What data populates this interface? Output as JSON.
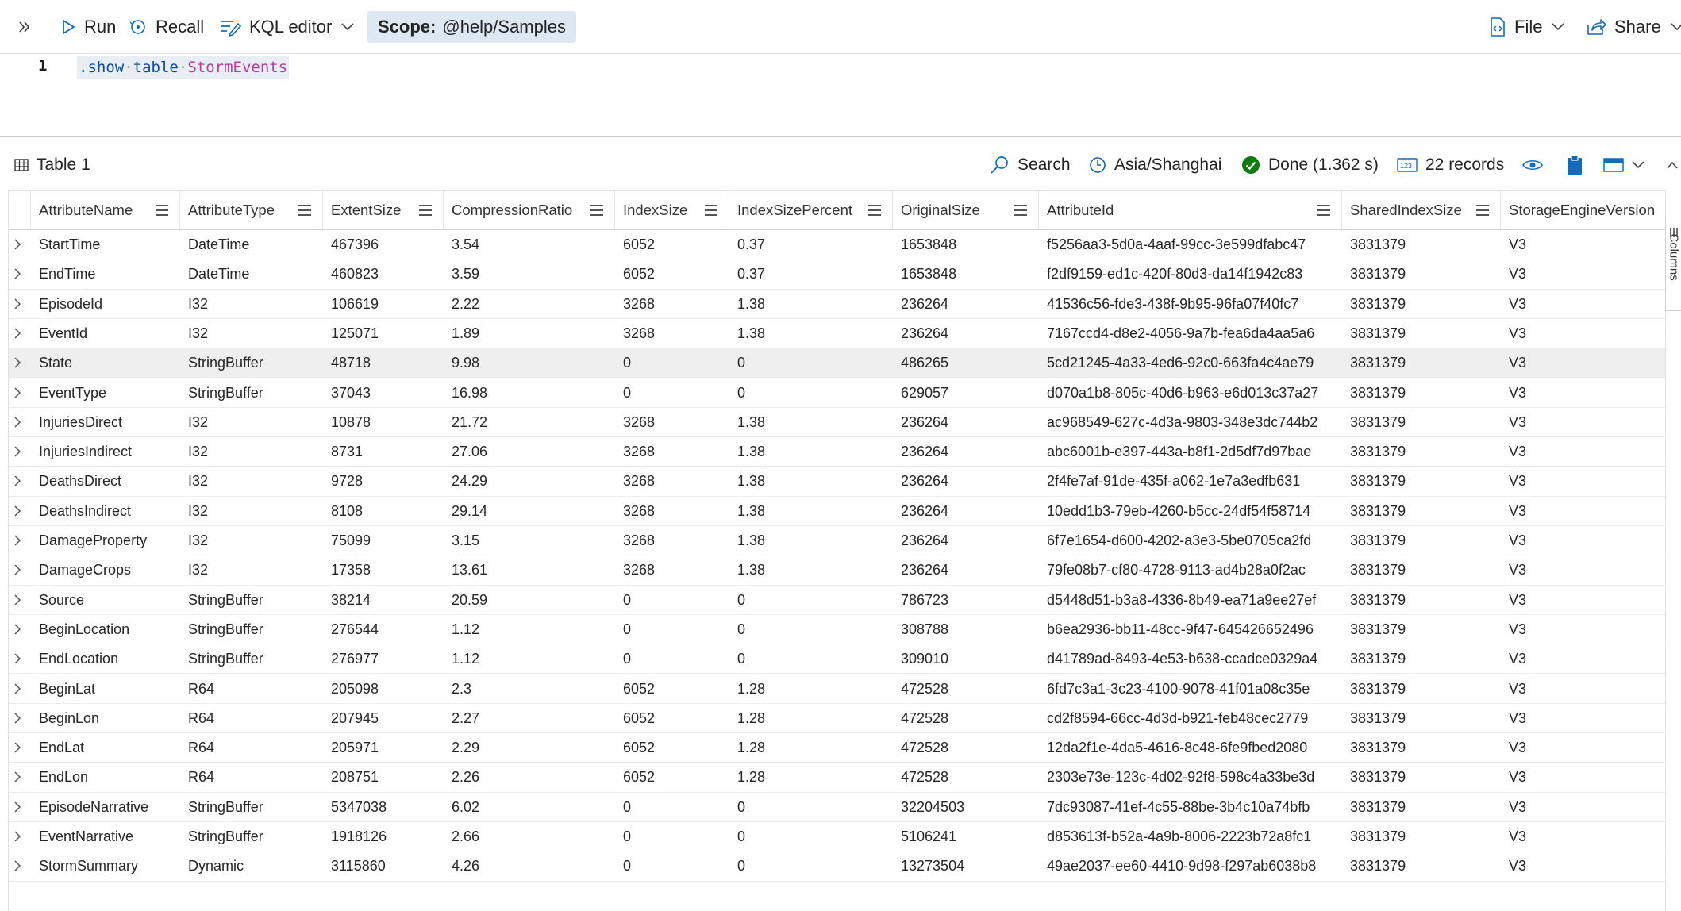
{
  "toolbar": {
    "run_label": "Run",
    "recall_label": "Recall",
    "editor_mode_label": "KQL editor",
    "scope_key": "Scope:",
    "scope_value": "@help/Samples",
    "file_label": "File",
    "share_label": "Share"
  },
  "editor": {
    "line_number": "1",
    "code": {
      "cmd": ".show",
      "kw": "table",
      "tbl": "StormEvents"
    }
  },
  "results": {
    "tab_label": "Table 1",
    "search_label": "Search",
    "timezone_label": "Asia/Shanghai",
    "status_label": "Done (1.362 s)",
    "records_label": "22 records",
    "columns_panel_label": "Columns",
    "status_color": "#107c10",
    "accent_color": "#0f6cbd"
  },
  "table": {
    "columns": [
      "AttributeName",
      "AttributeType",
      "ExtentSize",
      "CompressionRatio",
      "IndexSize",
      "IndexSizePercent",
      "OriginalSize",
      "AttributeId",
      "SharedIndexSize",
      "StorageEngineVersion"
    ],
    "rows": [
      [
        "StartTime",
        "DateTime",
        "467396",
        "3.54",
        "6052",
        "0.37",
        "1653848",
        "f5256aa3-5d0a-4aaf-99cc-3e599dfabc47",
        "3831379",
        "V3"
      ],
      [
        "EndTime",
        "DateTime",
        "460823",
        "3.59",
        "6052",
        "0.37",
        "1653848",
        "f2df9159-ed1c-420f-80d3-da14f1942c83",
        "3831379",
        "V3"
      ],
      [
        "EpisodeId",
        "I32",
        "106619",
        "2.22",
        "3268",
        "1.38",
        "236264",
        "41536c56-fde3-438f-9b95-96fa07f40fc7",
        "3831379",
        "V3"
      ],
      [
        "EventId",
        "I32",
        "125071",
        "1.89",
        "3268",
        "1.38",
        "236264",
        "7167ccd4-d8e2-4056-9a7b-fea6da4aa5a6",
        "3831379",
        "V3"
      ],
      [
        "State",
        "StringBuffer",
        "48718",
        "9.98",
        "0",
        "0",
        "486265",
        "5cd21245-4a33-4ed6-92c0-663fa4c4ae79",
        "3831379",
        "V3"
      ],
      [
        "EventType",
        "StringBuffer",
        "37043",
        "16.98",
        "0",
        "0",
        "629057",
        "d070a1b8-805c-40d6-b963-e6d013c37a27",
        "3831379",
        "V3"
      ],
      [
        "InjuriesDirect",
        "I32",
        "10878",
        "21.72",
        "3268",
        "1.38",
        "236264",
        "ac968549-627c-4d3a-9803-348e3dc744b2",
        "3831379",
        "V3"
      ],
      [
        "InjuriesIndirect",
        "I32",
        "8731",
        "27.06",
        "3268",
        "1.38",
        "236264",
        "abc6001b-e397-443a-b8f1-2d5df7d97bae",
        "3831379",
        "V3"
      ],
      [
        "DeathsDirect",
        "I32",
        "9728",
        "24.29",
        "3268",
        "1.38",
        "236264",
        "2f4fe7af-91de-435f-a062-1e7a3edfb631",
        "3831379",
        "V3"
      ],
      [
        "DeathsIndirect",
        "I32",
        "8108",
        "29.14",
        "3268",
        "1.38",
        "236264",
        "10edd1b3-79eb-4260-b5cc-24df54f58714",
        "3831379",
        "V3"
      ],
      [
        "DamageProperty",
        "I32",
        "75099",
        "3.15",
        "3268",
        "1.38",
        "236264",
        "6f7e1654-d600-4202-a3e3-5be0705ca2fd",
        "3831379",
        "V3"
      ],
      [
        "DamageCrops",
        "I32",
        "17358",
        "13.61",
        "3268",
        "1.38",
        "236264",
        "79fe08b7-cf80-4728-9113-ad4b28a0f2ac",
        "3831379",
        "V3"
      ],
      [
        "Source",
        "StringBuffer",
        "38214",
        "20.59",
        "0",
        "0",
        "786723",
        "d5448d51-b3a8-4336-8b49-ea71a9ee27ef",
        "3831379",
        "V3"
      ],
      [
        "BeginLocation",
        "StringBuffer",
        "276544",
        "1.12",
        "0",
        "0",
        "308788",
        "b6ea2936-bb11-48cc-9f47-645426652496",
        "3831379",
        "V3"
      ],
      [
        "EndLocation",
        "StringBuffer",
        "276977",
        "1.12",
        "0",
        "0",
        "309010",
        "d41789ad-8493-4e53-b638-ccadce0329a4",
        "3831379",
        "V3"
      ],
      [
        "BeginLat",
        "R64",
        "205098",
        "2.3",
        "6052",
        "1.28",
        "472528",
        "6fd7c3a1-3c23-4100-9078-41f01a08c35e",
        "3831379",
        "V3"
      ],
      [
        "BeginLon",
        "R64",
        "207945",
        "2.27",
        "6052",
        "1.28",
        "472528",
        "cd2f8594-66cc-4d3d-b921-feb48cec2779",
        "3831379",
        "V3"
      ],
      [
        "EndLat",
        "R64",
        "205971",
        "2.29",
        "6052",
        "1.28",
        "472528",
        "12da2f1e-4da5-4616-8c48-6fe9fbed2080",
        "3831379",
        "V3"
      ],
      [
        "EndLon",
        "R64",
        "208751",
        "2.26",
        "6052",
        "1.28",
        "472528",
        "2303e73e-123c-4d02-92f8-598c4a33be3d",
        "3831379",
        "V3"
      ],
      [
        "EpisodeNarrative",
        "StringBuffer",
        "5347038",
        "6.02",
        "0",
        "0",
        "32204503",
        "7dc93087-41ef-4c55-88be-3b4c10a74bfb",
        "3831379",
        "V3"
      ],
      [
        "EventNarrative",
        "StringBuffer",
        "1918126",
        "2.66",
        "0",
        "0",
        "5106241",
        "d853613f-b52a-4a9b-8006-2223b72a8fc1",
        "3831379",
        "V3"
      ],
      [
        "StormSummary",
        "Dynamic",
        "3115860",
        "4.26",
        "0",
        "0",
        "13273504",
        "49ae2037-ee60-4410-9d98-f297ab6038b8",
        "3831379",
        "V3"
      ]
    ],
    "selected_row_index": 4
  }
}
